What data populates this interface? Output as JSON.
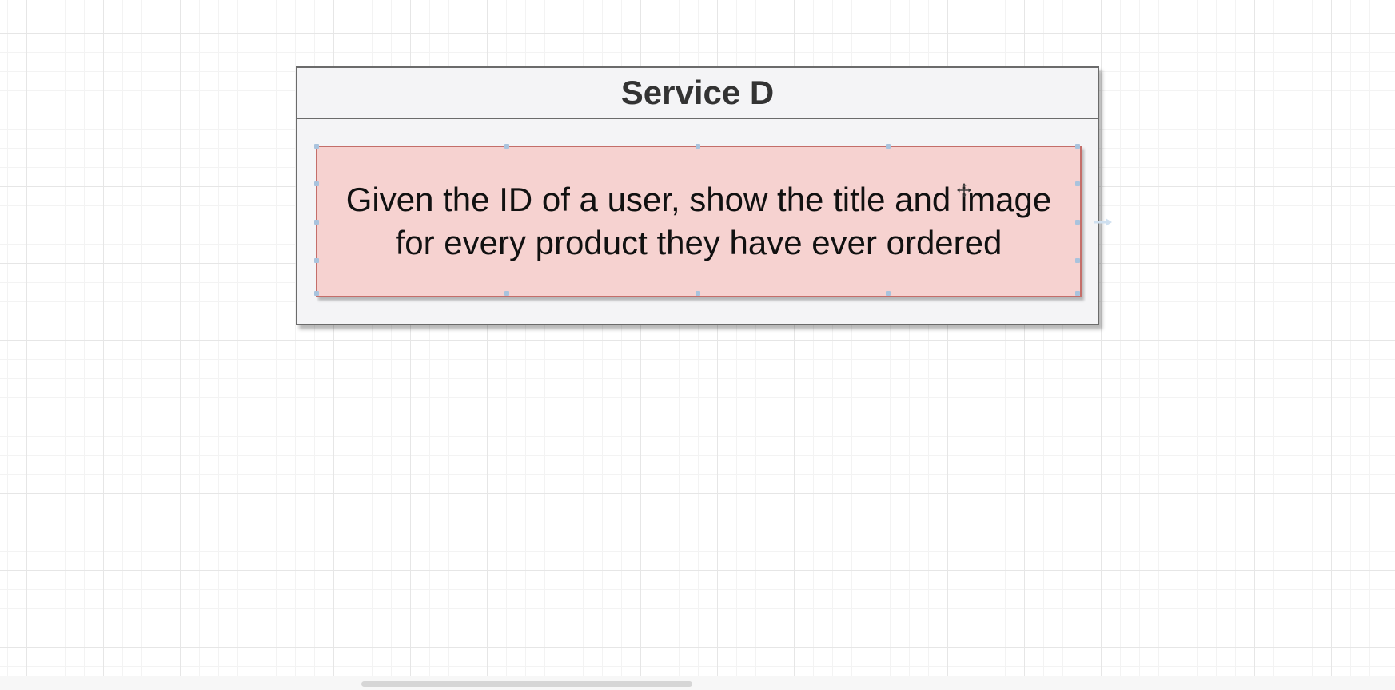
{
  "diagram": {
    "container": {
      "title": "Service D"
    },
    "note": {
      "text": "Given the ID of a user, show the title and image for every product they have ever ordered"
    }
  },
  "icons": {
    "cursor": "move-cursor-icon",
    "connector": "connector-arrow-icon"
  },
  "colors": {
    "note_fill": "#f6d2d0",
    "note_border": "#c46e6a",
    "container_fill": "#f4f4f6",
    "grid_line": "#e6e6e6"
  }
}
